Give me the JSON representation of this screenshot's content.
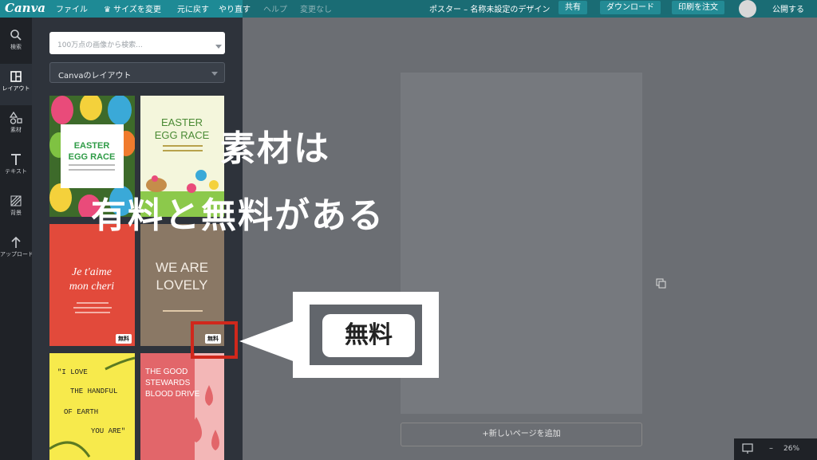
{
  "topbar": {
    "logo": "Canva",
    "file": "ファイル",
    "resize": "♛ サイズを変更",
    "undo": "元に戻す",
    "redo": "やり直す",
    "help": "ヘルプ",
    "changes": "変更なし",
    "doc_title": "ポスター – 名称未設定のデザイン",
    "share": "共有",
    "download": "ダウンロード",
    "print": "印刷を注文",
    "publish": "公開する"
  },
  "rail": {
    "items": [
      {
        "label": "検索",
        "icon": "search-icon"
      },
      {
        "label": "レイアウト",
        "icon": "layout-icon"
      },
      {
        "label": "素材",
        "icon": "shapes-icon"
      },
      {
        "label": "テキスト",
        "icon": "text-icon"
      },
      {
        "label": "背景",
        "icon": "background-icon"
      },
      {
        "label": "アップロード",
        "icon": "upload-icon"
      }
    ]
  },
  "panel": {
    "search_placeholder": "100万点の画像から検索...",
    "layout_select": "Canvaのレイアウト",
    "templates": [
      {
        "title": "EASTER EGG RACE"
      },
      {
        "title": "EASTER EGG RACE"
      },
      {
        "title": "Je t'aime mon cheri"
      },
      {
        "title": "WE ARE LOVELY",
        "badge": "無料"
      },
      {
        "title": "\"I LOVE THE HANDFUL OF EARTH YOU ARE\""
      },
      {
        "title": "THE GOOD STEWARDS BLOOD DRIVE"
      }
    ],
    "badge_first": "無料"
  },
  "canvas": {
    "add_page": "+新しいページを追加",
    "zoom": "26%"
  },
  "overlay": {
    "line1": "素材は",
    "line2": "有料と無料がある",
    "callout_label": "無料"
  },
  "colors": {
    "accent": "#1e8a95",
    "highlight": "#d0281c"
  }
}
